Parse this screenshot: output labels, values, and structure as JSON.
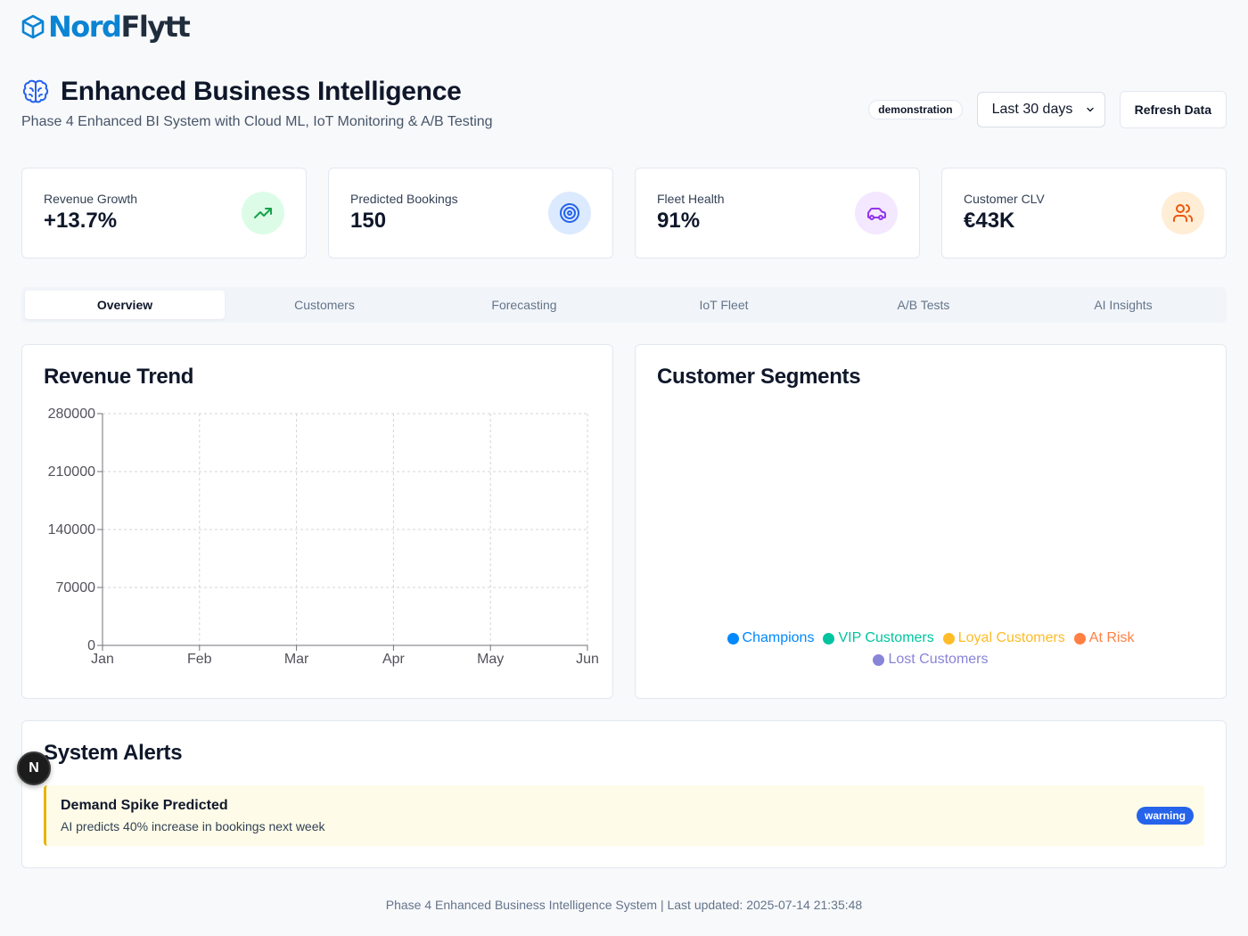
{
  "brand": {
    "name_part1": "Nord",
    "name_part2": "Flytt"
  },
  "header": {
    "title": "Enhanced Business Intelligence",
    "subtitle": "Phase 4 Enhanced BI System with Cloud ML, IoT Monitoring & A/B Testing",
    "mode_badge": "demonstration",
    "date_range": "Last 30 days",
    "refresh_label": "Refresh Data"
  },
  "kpis": [
    {
      "label": "Revenue Growth",
      "value": "+13.7%",
      "icon": "trending-up-icon",
      "icon_color": "#16a34a",
      "icon_bg": "#dcfce7"
    },
    {
      "label": "Predicted Bookings",
      "value": "150",
      "icon": "target-icon",
      "icon_color": "#2563eb",
      "icon_bg": "#dbeafe"
    },
    {
      "label": "Fleet Health",
      "value": "91%",
      "icon": "car-icon",
      "icon_color": "#9333ea",
      "icon_bg": "#f3e8ff"
    },
    {
      "label": "Customer CLV",
      "value": "€43K",
      "icon": "users-icon",
      "icon_color": "#ea580c",
      "icon_bg": "#ffedd5"
    }
  ],
  "tabs": [
    "Overview",
    "Customers",
    "Forecasting",
    "IoT Fleet",
    "A/B Tests",
    "AI Insights"
  ],
  "revenue_card": {
    "title": "Revenue Trend"
  },
  "segments_card": {
    "title": "Customer Segments",
    "legend": [
      {
        "name": "Champions",
        "color": "#0088fe"
      },
      {
        "name": "VIP Customers",
        "color": "#00c49f"
      },
      {
        "name": "Loyal Customers",
        "color": "#ffbb28"
      },
      {
        "name": "At Risk",
        "color": "#ff8042"
      },
      {
        "name": "Lost Customers",
        "color": "#8884d8"
      }
    ]
  },
  "alerts_card": {
    "title": "System Alerts",
    "alerts": [
      {
        "title": "Demand Spike Predicted",
        "message": "AI predicts 40% increase in bookings next week",
        "level": "warning"
      }
    ]
  },
  "dev_indicator": "N",
  "footer": "Phase 4 Enhanced Business Intelligence System | Last updated: 2025-07-14 21:35:48",
  "chart_data": {
    "type": "line",
    "title": "Revenue Trend",
    "categories": [
      "Jan",
      "Feb",
      "Mar",
      "Apr",
      "May",
      "Jun"
    ],
    "series": [],
    "y_ticks": [
      "0",
      "70000",
      "140000",
      "210000",
      "280000"
    ],
    "ylim": [
      0,
      280000
    ],
    "grid": true,
    "xlabel": "",
    "ylabel": ""
  }
}
